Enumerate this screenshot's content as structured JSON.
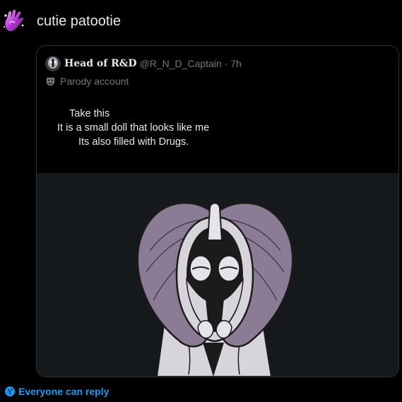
{
  "post": {
    "avatar_icon": "purple-hand-emoji",
    "text": "cutie patootie"
  },
  "quote": {
    "avatar_icon": "profile-avatar",
    "display_name": "Head of R&D",
    "handle": "@R_N_D_Captain",
    "separator": "·",
    "time": "7h",
    "parody_icon": "theater-mask-icon",
    "parody_label": "Parody account",
    "body_lines": [
      "Take this",
      "It is a small doll that looks like me",
      "Its also filled with Drugs."
    ],
    "media_alt": "drawing of a masked figure"
  },
  "footer": {
    "reply_icon": "globe-icon",
    "reply_label": "Everyone can reply"
  },
  "colors": {
    "background": "#000000",
    "text": "#e7e9ea",
    "muted": "#71767b",
    "accent": "#1d9bf0",
    "media_bg": "#15191b",
    "hair_purple": "#8c7b94"
  }
}
